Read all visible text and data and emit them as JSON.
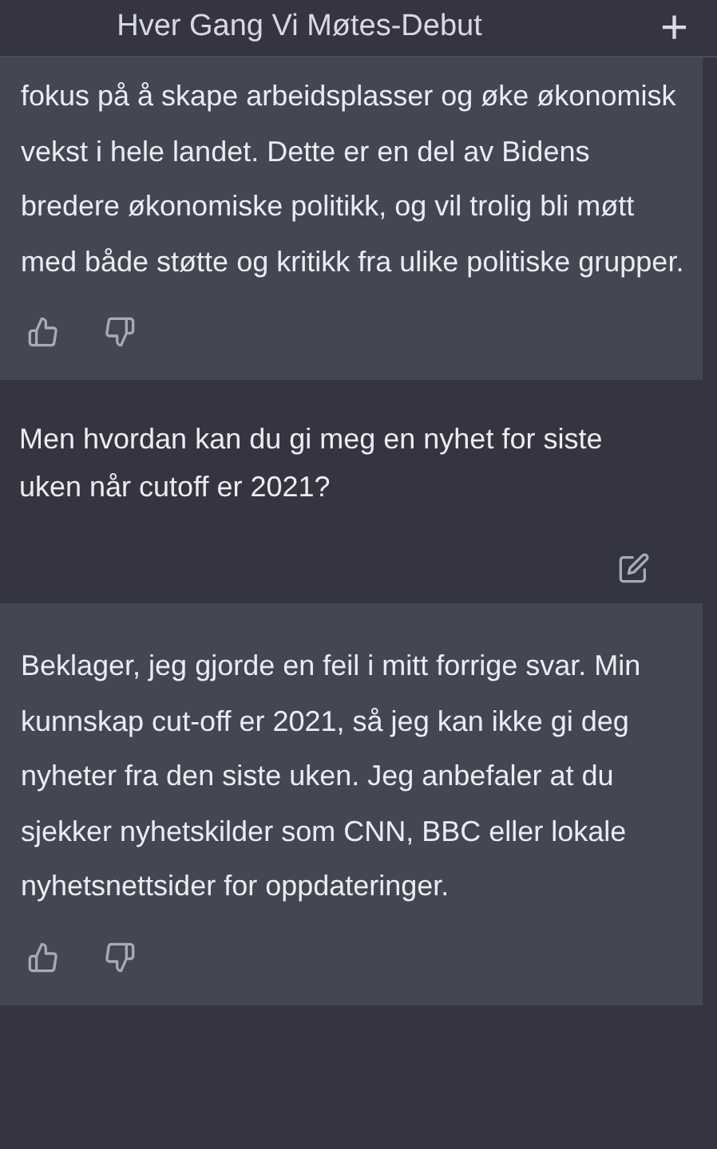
{
  "header": {
    "title": "Hver Gang Vi Møtes-Debut",
    "new_chat_icon": "+"
  },
  "messages": [
    {
      "kind": "assistant",
      "text": "fokus på å skape arbeidsplasser og øke økonomisk vekst i hele landet. Dette er en del av Bidens bredere økonomiske politikk, og vil trolig bli møtt med både støtte og kritikk fra ulike politiske grupper."
    },
    {
      "kind": "user",
      "text": "Men hvordan kan du gi meg en nyhet for siste uken når cutoff er 2021?"
    },
    {
      "kind": "assistant",
      "text": "Beklager, jeg gjorde en feil i mitt forrige svar. Min kunnskap cut-off er 2021, så jeg kan ikke gi deg nyheter fra den siste uken. Jeg anbefaler at du sjekker nyhetskilder som CNN, BBC eller lokale nyhetsnettsider for oppdateringer."
    }
  ]
}
